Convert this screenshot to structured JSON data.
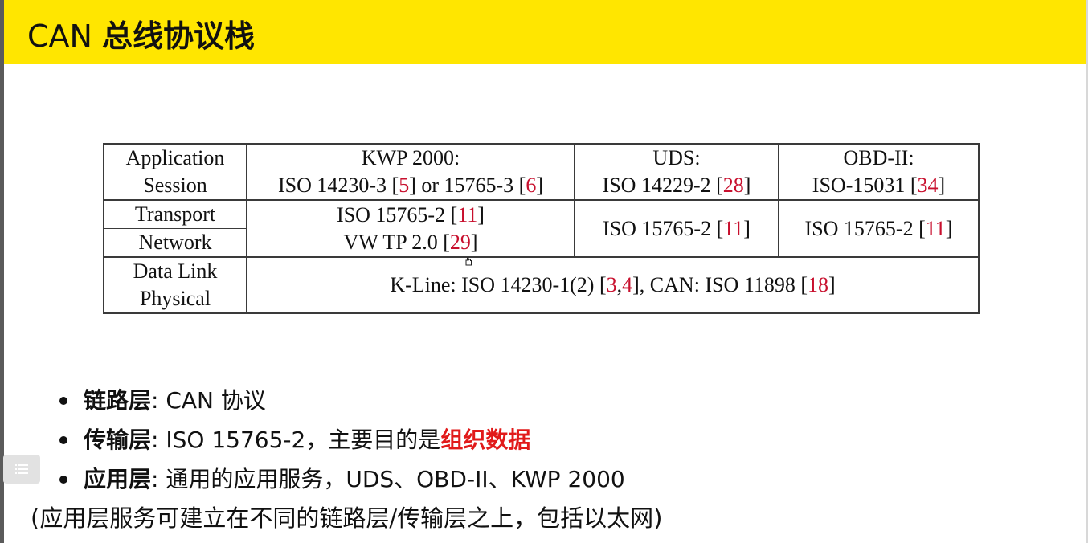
{
  "page": {
    "title_latin": "CAN ",
    "title_cn": "总线协议栈"
  },
  "table": {
    "layers": {
      "application": "Application",
      "session": "Session",
      "transport": "Transport",
      "network": "Network",
      "data_link": "Data Link",
      "physical": "Physical"
    },
    "kwp": {
      "header": "KWP 2000:",
      "line_pre": "ISO 14230-3 [",
      "ref1": "5",
      "line_mid": "] or 15765-3 [",
      "ref2": "6",
      "line_post": "]"
    },
    "uds": {
      "header": "UDS:",
      "line_pre": "ISO 14229-2 [",
      "ref": "28",
      "line_post": "]"
    },
    "obd": {
      "header": "OBD-II:",
      "line_pre": "ISO-15031 [",
      "ref": "34",
      "line_post": "]"
    },
    "transport_kwp": {
      "line1_pre": "ISO 15765-2 [",
      "line1_ref": "11",
      "line1_post": "]",
      "line2_pre": "VW TP 2.0 [",
      "line2_ref": "29",
      "line2_post": "]"
    },
    "transport_uds": {
      "pre": "ISO 15765-2 [",
      "ref": "11",
      "post": "]"
    },
    "transport_obd": {
      "pre": "ISO 15765-2 [",
      "ref": "11",
      "post": "]"
    },
    "datalink": {
      "pre": "K-Line: ISO 14230-1(2) [",
      "ref1": "3",
      "sep": ",",
      "ref2": "4",
      "mid": "], CAN: ISO 11898 [",
      "ref3": "18",
      "post": "]"
    }
  },
  "bullets": [
    {
      "term": "链路层",
      "text": ":  CAN 协议"
    },
    {
      "term": "传输层",
      "text": ":  ISO 15765-2，主要目的是",
      "highlight": "组织数据"
    },
    {
      "term": "应用层",
      "text": ":  通用的应用服务，UDS、OBD-II、KWP 2000"
    }
  ],
  "footnote": "(应用层服务可建立在不同的链路层/传输层之上，包括以太网)",
  "icons": {
    "side_button": "list-icon",
    "cursor": "hand-cursor-icon"
  },
  "colors": {
    "header_bg": "#ffe600",
    "reference": "#c8102e",
    "highlight": "#e11a1a"
  }
}
